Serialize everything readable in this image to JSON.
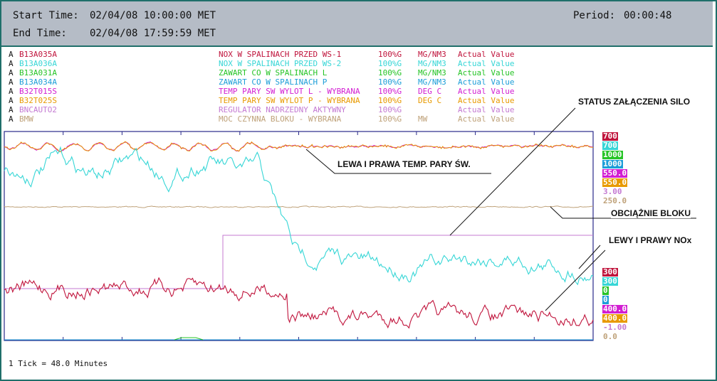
{
  "header": {
    "start_label": "Start Time:",
    "start_value": "02/04/08 10:00:00 MET",
    "end_label": "End Time:",
    "end_value": "02/04/08 17:59:59 MET",
    "period_label": "Period:",
    "period_value": "00:00:48"
  },
  "legend": [
    {
      "a": "A",
      "tag": "B13A035A",
      "desc": "NOX W SPALINACH PRZED WS-1",
      "pct": "100%G",
      "unit": "MG/NM3",
      "kind": "Actual Value",
      "color": "#c0143c"
    },
    {
      "a": "A",
      "tag": "B13A036A",
      "desc": "NOX W SPALINACH PRZED WS-2",
      "pct": "100%G",
      "unit": "MG/NM3",
      "kind": "Actual Value",
      "color": "#36d6d6"
    },
    {
      "a": "A",
      "tag": "B13A031A",
      "desc": "ZAWART CO W SPALINACH L",
      "pct": "100%G",
      "unit": "MG/NM3",
      "kind": "Actual Value",
      "color": "#26c426"
    },
    {
      "a": "A",
      "tag": "B13A034A",
      "desc": "ZAWART CO W SPALINACH P",
      "pct": "100%G",
      "unit": "MG/NM3",
      "kind": "Actual Value",
      "color": "#1c9ed8"
    },
    {
      "a": "A",
      "tag": "B32T015S",
      "desc": "TEMP PARY SW WYLOT L - WYBRANA",
      "pct": "100%G",
      "unit": "DEG C",
      "kind": "Actual Value",
      "color": "#d21ed2"
    },
    {
      "a": "A",
      "tag": "B32T025S",
      "desc": "TEMP PARY SW WYLOT P - WYBRANA",
      "pct": "100%G",
      "unit": "DEG C",
      "kind": "Actual Value",
      "color": "#e89a00"
    },
    {
      "a": "A",
      "tag": "BNCAUTO2",
      "desc": "REGULATOR NADRZEDNY AKTYWNY",
      "pct": "100%G",
      "unit": "",
      "kind": "Actual Value",
      "color": "#c47ad2"
    },
    {
      "a": "A",
      "tag": "BMW",
      "desc": "MOC CZYNNA BLOKU - WYBRANA",
      "pct": "100%G",
      "unit": "MW",
      "kind": "Actual Value",
      "color": "#bfa27a"
    }
  ],
  "upper_scale": [
    {
      "text": "700",
      "color": "#c0143c"
    },
    {
      "text": "700",
      "color": "#36d6d6"
    },
    {
      "text": "1000",
      "color": "#26c426"
    },
    {
      "text": "1000",
      "color": "#1c9ed8"
    },
    {
      "text": "550.0",
      "color": "#d21ed2"
    },
    {
      "text": "550.0",
      "color": "#e89a00"
    },
    {
      "text": "3.00",
      "color": "#c47ad2"
    },
    {
      "text": "250.0",
      "color": "#bfa27a"
    }
  ],
  "lower_scale": [
    {
      "text": "300",
      "color": "#c0143c"
    },
    {
      "text": "300",
      "color": "#36d6d6"
    },
    {
      "text": "0",
      "color": "#26c426"
    },
    {
      "text": "0",
      "color": "#1c9ed8"
    },
    {
      "text": "400.0",
      "color": "#d21ed2"
    },
    {
      "text": "400.0",
      "color": "#e89a00"
    },
    {
      "text": "-1.00",
      "color": "#c47ad2"
    },
    {
      "text": "0.0",
      "color": "#bfa27a"
    }
  ],
  "annotations": {
    "status": "STATUS ZAŁĄCZENIA SILO",
    "temp": "LEWA I PRAWA TEMP. PARY ŚW.",
    "load": "OBCIĄŻNIE BLOKU",
    "nox": "LEWY I PRAWY NOx"
  },
  "footer": "1 Tick = 48.0 Minutes",
  "colors": {
    "frame": "#1f6f6a",
    "header_bg": "#b5bcc6",
    "plot_border": "#2a2a8a"
  }
}
